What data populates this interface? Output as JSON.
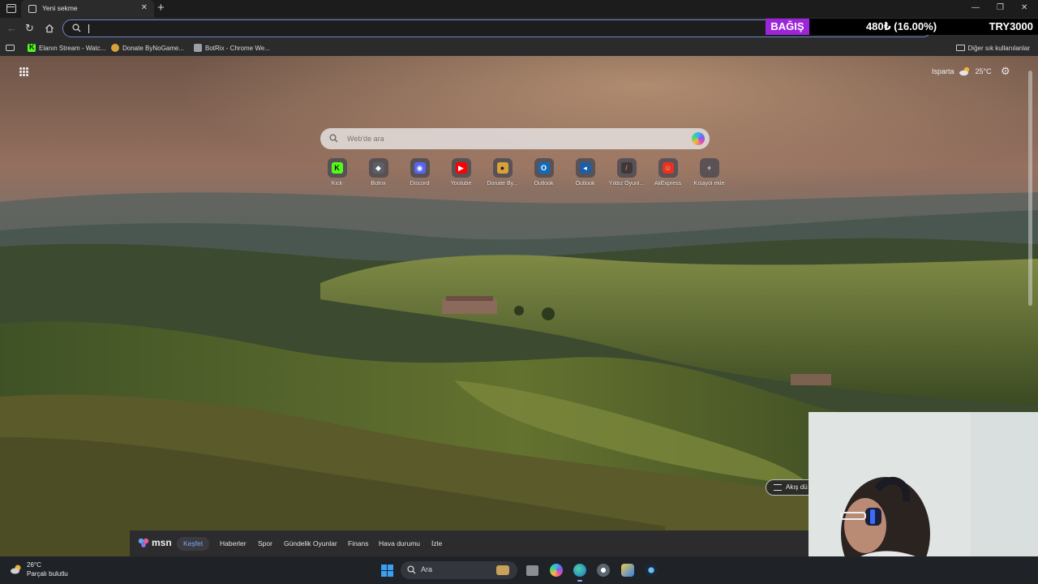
{
  "browser": {
    "tab": {
      "title": "Yeni sekme"
    },
    "address_bar": {
      "value": "",
      "placeholder": ""
    },
    "bookmarks": [
      {
        "label": "Elanın Stream - Watc...",
        "icon": "kick-icon"
      },
      {
        "label": "Donate ByNoGame...",
        "icon": "bynogame-icon"
      },
      {
        "label": "BotRix - Chrome We...",
        "icon": "botrix-icon"
      }
    ],
    "other_bookmarks": "Diğer sık kullanılanlar"
  },
  "donation": {
    "badge": "BAĞIŞ",
    "amount": "480₺ (16.00%)",
    "goal": "TRY3000",
    "badge_color": "#9c25d9"
  },
  "new_tab": {
    "weather": {
      "location": "Isparta",
      "temperature": "25°C"
    },
    "search": {
      "placeholder": "Web'de ara"
    },
    "quick_links": [
      {
        "label": "Kick",
        "glyph": "K",
        "color": "#53fc18",
        "text_color": "#111111"
      },
      {
        "label": "Botrix",
        "glyph": "◆",
        "color": "#5b5f66",
        "text_color": "#ffffff"
      },
      {
        "label": "Discord",
        "glyph": "◉",
        "color": "#5865f2",
        "text_color": "#ffffff"
      },
      {
        "label": "Youtube",
        "glyph": "▶",
        "color": "#ff0000",
        "text_color": "#ffffff"
      },
      {
        "label": "Donate By...",
        "glyph": "●",
        "color": "#d9a13b",
        "text_color": "#222222"
      },
      {
        "label": "Outlook",
        "glyph": "O",
        "color": "#0f6cbd",
        "text_color": "#ffffff"
      },
      {
        "label": "Outlook",
        "glyph": "◂",
        "color": "#1a5fa8",
        "text_color": "#ffffff"
      },
      {
        "label": "Yıldız Oyunl...",
        "glyph": "/",
        "color": "#3a3a3a",
        "text_color": "#ff5a4a"
      },
      {
        "label": "AliExpress",
        "glyph": "☺",
        "color": "#e43225",
        "text_color": "#ffd24a"
      },
      {
        "label": "Kısayol ekle",
        "glyph": "+",
        "color": "transparent",
        "text_color": "#cccccc"
      }
    ],
    "msn": {
      "logo": "msn",
      "tabs": [
        "Keşfet",
        "Haberler",
        "Spor",
        "Gündelik Oyunlar",
        "Finans",
        "Hava durumu",
        "İzle"
      ],
      "active_tab": "Keşfet",
      "layout_button": "Akış dü"
    }
  },
  "taskbar": {
    "weather": {
      "temp": "26°C",
      "condition": "Parçalı bulutlu"
    },
    "search_label": "Ara",
    "apps": [
      "task-view-icon",
      "copilot-icon",
      "edge-icon",
      "chrome-icon",
      "app-icon",
      "steam-icon"
    ]
  }
}
